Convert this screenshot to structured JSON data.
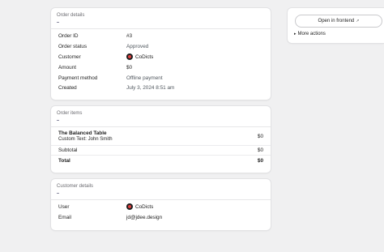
{
  "order_details": {
    "title": "Order details",
    "rows": [
      {
        "label": "Order ID",
        "value": "#3"
      },
      {
        "label": "Order status",
        "value": "Approved"
      },
      {
        "label": "Customer",
        "value": "CoDicts"
      },
      {
        "label": "Amount",
        "value": "$0"
      },
      {
        "label": "Payment method",
        "value": "Offline payment"
      },
      {
        "label": "Created",
        "value": "July 3, 2024 8:51 am"
      }
    ]
  },
  "order_items": {
    "title": "Order items",
    "item_name": "The Balanced Table",
    "item_custom": "Custom Text: John Smith",
    "item_price": "$0",
    "subtotal_label": "Subtotal",
    "subtotal_value": "$0",
    "total_label": "Total",
    "total_value": "$0"
  },
  "customer_details": {
    "title": "Customer details",
    "user_label": "User",
    "user_value": "CoDicts",
    "email_label": "Email",
    "email_value": "jd@jdee.design"
  },
  "sidebar": {
    "open_frontend_label": "Open in frontend",
    "more_actions_label": "More actions"
  },
  "icons": {
    "external": "external-link-icon",
    "chevron": "chevron-right-icon",
    "avatar": "avatar"
  }
}
